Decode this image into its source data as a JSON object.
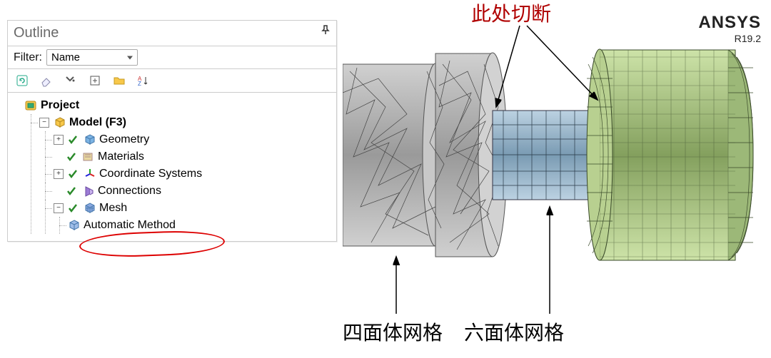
{
  "panel": {
    "title": "Outline",
    "filterLabel": "Filter:",
    "filterValue": "Name"
  },
  "tree": {
    "project": "Project",
    "model": "Model (F3)",
    "geometry": "Geometry",
    "materials": "Materials",
    "coord": "Coordinate Systems",
    "connections": "Connections",
    "mesh": "Mesh",
    "automethod": "Automatic Method"
  },
  "annotations": {
    "cutHere": "此处切断",
    "tetMesh": "四面体网格",
    "hexMesh": "六面体网格"
  },
  "brand": {
    "name": "ANSYS",
    "ver": "R19.2"
  }
}
